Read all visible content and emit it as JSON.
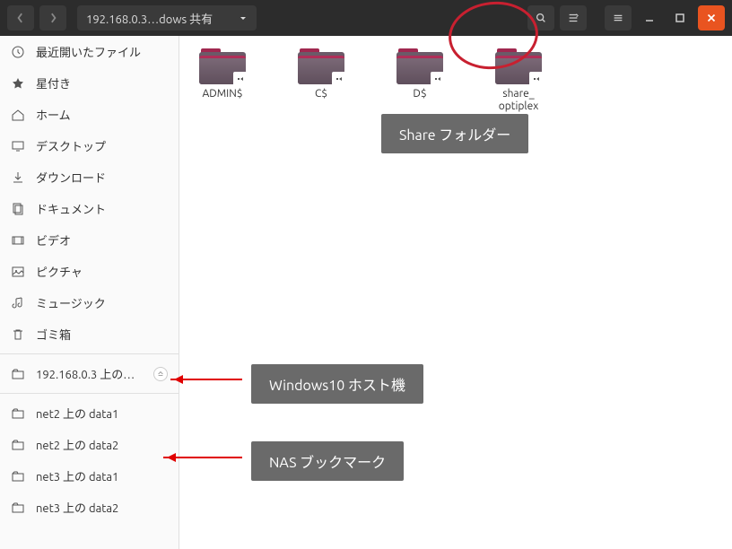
{
  "titlebar": {
    "path": "192.168.0.3…dows 共有"
  },
  "sidebar": {
    "recent": "最近開いたファイル",
    "starred": "星付き",
    "home": "ホーム",
    "desktop": "デスクトップ",
    "downloads": "ダウンロード",
    "documents": "ドキュメント",
    "videos": "ビデオ",
    "pictures": "ピクチャ",
    "music": "ミュージック",
    "trash": "ゴミ箱",
    "mount1": "192.168.0.3 上の…",
    "bm1": "net2 上の data1",
    "bm2": "net2 上の data2",
    "bm3": "net3 上の data1",
    "bm4": "net3 上の data2"
  },
  "folders": {
    "f1": "ADMIN$",
    "f2": "C$",
    "f3": "D$",
    "f4": "share_\noptiplex"
  },
  "annotations": {
    "share": "Share フォルダー",
    "win": "Windows10 ホスト機",
    "nas": "NAS ブックマーク"
  }
}
